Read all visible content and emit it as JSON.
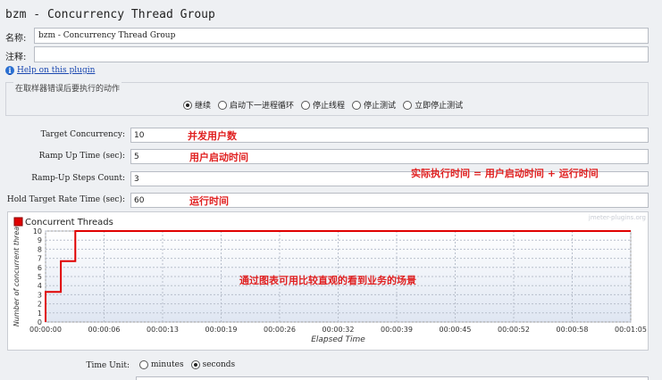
{
  "window": {
    "title": "bzm - Concurrency Thread Group"
  },
  "name_row": {
    "label": "名称:",
    "value": "bzm - Concurrency Thread Group"
  },
  "comment_row": {
    "label": "注释:",
    "value": ""
  },
  "help_link": {
    "text": "Help on this plugin",
    "icon": "info-icon"
  },
  "sampler_error": {
    "title": "在取样器错误后要执行的动作",
    "options": [
      "继续",
      "启动下一进程循环",
      "停止线程",
      "停止测试",
      "立即停止测试"
    ],
    "selected": "继续"
  },
  "fields": {
    "target_concurrency": {
      "label": "Target Concurrency:",
      "value": "10"
    },
    "ramp_up_time": {
      "label": "Ramp Up Time (sec):",
      "value": "5"
    },
    "ramp_up_steps": {
      "label": "Ramp-Up Steps Count:",
      "value": "3"
    },
    "hold_time": {
      "label": "Hold Target Rate Time (sec):",
      "value": "60"
    }
  },
  "annotations": {
    "concurrency": "并发用户数",
    "ramp_up": "用户启动时间",
    "formula": "实际执行时间 = 用户启动时间 + 运行时间",
    "hold": "运行时间",
    "chart_note": "通过图表可用比较直观的看到业务的场景"
  },
  "time_unit": {
    "label": "Time Unit:",
    "options": [
      "minutes",
      "seconds"
    ],
    "selected": "seconds"
  },
  "chart_data": {
    "type": "line",
    "watermark": "jmeter-plugins.org",
    "legend": [
      "Concurrent Threads"
    ],
    "xlabel": "Elapsed Time",
    "ylabel": "Number of concurrent threa",
    "yticks": [
      0,
      1,
      2,
      3,
      4,
      5,
      6,
      7,
      8,
      9,
      10
    ],
    "xticks": [
      "00:00:00",
      "00:00:06",
      "00:00:13",
      "00:00:19",
      "00:00:26",
      "00:00:32",
      "00:00:39",
      "00:00:45",
      "00:00:52",
      "00:00:58",
      "00:01:05"
    ],
    "xlim_sec": [
      0,
      65
    ],
    "ylim": [
      0,
      10
    ],
    "series": [
      {
        "name": "Concurrent Threads",
        "color": "#e00000",
        "points": [
          [
            0,
            0
          ],
          [
            0,
            3.3
          ],
          [
            1.7,
            3.3
          ],
          [
            1.7,
            6.7
          ],
          [
            3.3,
            6.7
          ],
          [
            3.3,
            10
          ],
          [
            65,
            10
          ]
        ]
      }
    ]
  }
}
